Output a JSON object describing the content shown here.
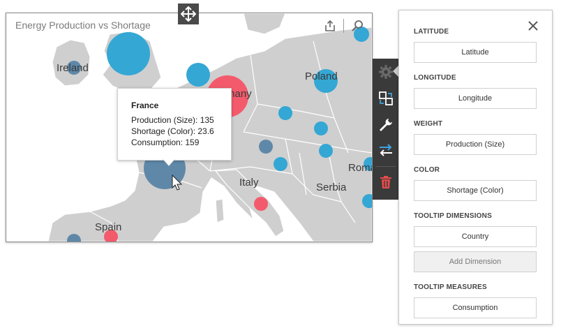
{
  "widget": {
    "title": "Energy Production vs Shortage",
    "tools": [
      {
        "icon": "export-icon"
      },
      {
        "icon": "zoom-icon"
      }
    ]
  },
  "map_labels": {
    "ireland": "Ireland",
    "poland": "Poland",
    "germany": "Germany",
    "italy": "Italy",
    "serbia": "Serbia",
    "romania": "Romania",
    "spain": "Spain"
  },
  "colors": {
    "land": "#cfcfcf",
    "border": "#ffffff",
    "sea": "#ffffff",
    "bubble_blue": "#34a7d4",
    "bubble_dark": "#5f88a8",
    "bubble_red": "#f35b6c",
    "toolbar": "#3a3a3a"
  },
  "tooltip": {
    "country": "France",
    "production": "Production (Size): 135",
    "shortage": "Shortage (Color): 23.6",
    "consumption": "Consumption: 159"
  },
  "side_toolbar": [
    {
      "icon": "gear-icon"
    },
    {
      "icon": "binding-icon"
    },
    {
      "icon": "wrench-icon"
    },
    {
      "icon": "convert-icon"
    },
    {
      "icon": "delete-icon"
    }
  ],
  "panel": {
    "latitude_label": "LATITUDE",
    "latitude_value": "Latitude",
    "longitude_label": "LONGITUDE",
    "longitude_value": "Longitude",
    "weight_label": "WEIGHT",
    "weight_value": "Production (Size)",
    "color_label": "COLOR",
    "color_value": "Shortage (Color)",
    "tooltip_dimensions_label": "TOOLTIP DIMENSIONS",
    "tooltip_dimensions_value": "Country",
    "add_dimension": "Add Dimension",
    "tooltip_measures_label": "TOOLTIP MEASURES",
    "tooltip_measures_value": "Consumption"
  }
}
